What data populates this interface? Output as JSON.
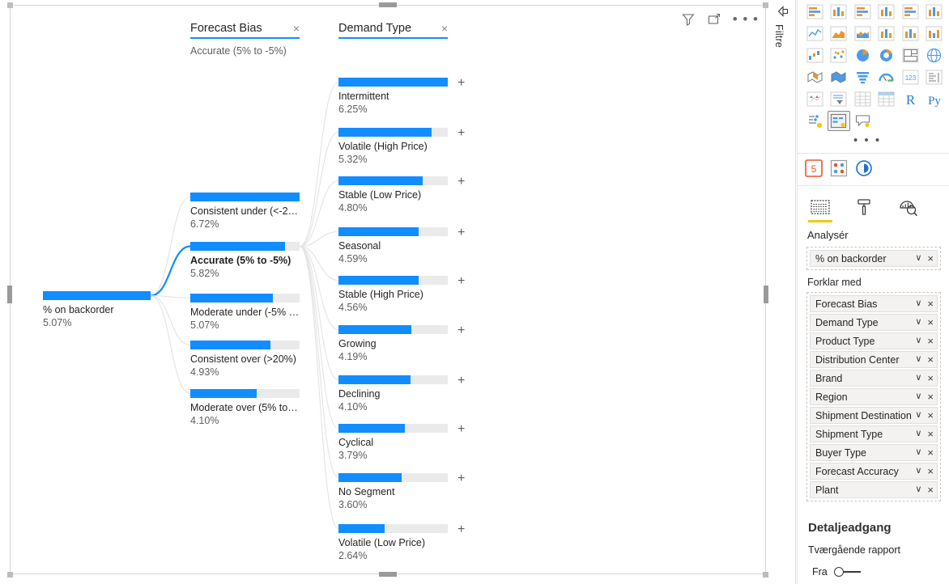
{
  "visual_toolbar": {
    "filter_icon": "funnel-icon",
    "focus_icon": "focus-mode-icon",
    "more_label": "• • •"
  },
  "filter_rail": {
    "collapse_icon": "collapse-pane-icon",
    "label": "Filtre"
  },
  "tree": {
    "root": {
      "label": "% on backorder",
      "value": "5.07%",
      "fill_ratio": 1.0,
      "selected": false
    },
    "levels": [
      {
        "title": "Forecast Bias",
        "subtitle": "Accurate (5% to -5%)",
        "close_label": "×",
        "nodes": [
          {
            "label": "Consistent under (<-2…",
            "value": "6.72%",
            "fill_ratio": 1.0,
            "selected": false,
            "expandable": false
          },
          {
            "label": "Accurate (5% to -5%)",
            "value": "5.82%",
            "fill_ratio": 0.866,
            "selected": true,
            "expandable": false
          },
          {
            "label": "Moderate under (-5% …",
            "value": "5.07%",
            "fill_ratio": 0.754,
            "selected": false,
            "expandable": false
          },
          {
            "label": "Consistent over (>20%)",
            "value": "4.93%",
            "fill_ratio": 0.734,
            "selected": false,
            "expandable": false
          },
          {
            "label": "Moderate over (5% to …",
            "value": "4.10%",
            "fill_ratio": 0.61,
            "selected": false,
            "expandable": false
          }
        ]
      },
      {
        "title": "Demand Type",
        "subtitle": "",
        "close_label": "×",
        "expand_label": "+",
        "nodes": [
          {
            "label": "Intermittent",
            "value": "6.25%",
            "fill_ratio": 1.0,
            "selected": false,
            "expandable": true
          },
          {
            "label": "Volatile (High Price)",
            "value": "5.32%",
            "fill_ratio": 0.851,
            "selected": false,
            "expandable": true
          },
          {
            "label": "Stable (Low Price)",
            "value": "4.80%",
            "fill_ratio": 0.768,
            "selected": false,
            "expandable": true
          },
          {
            "label": "Seasonal",
            "value": "4.59%",
            "fill_ratio": 0.734,
            "selected": false,
            "expandable": true
          },
          {
            "label": "Stable (High Price)",
            "value": "4.56%",
            "fill_ratio": 0.73,
            "selected": false,
            "expandable": true
          },
          {
            "label": "Growing",
            "value": "4.19%",
            "fill_ratio": 0.67,
            "selected": false,
            "expandable": true
          },
          {
            "label": "Declining",
            "value": "4.10%",
            "fill_ratio": 0.656,
            "selected": false,
            "expandable": true
          },
          {
            "label": "Cyclical",
            "value": "3.79%",
            "fill_ratio": 0.606,
            "selected": false,
            "expandable": true
          },
          {
            "label": "No Segment",
            "value": "3.60%",
            "fill_ratio": 0.576,
            "selected": false,
            "expandable": true
          },
          {
            "label": "Volatile (Low Price)",
            "value": "2.64%",
            "fill_ratio": 0.422,
            "selected": false,
            "expandable": true
          }
        ]
      }
    ]
  },
  "pane": {
    "gallery_icons": [
      "stacked-bar-chart-icon",
      "stacked-column-chart-icon",
      "clustered-bar-chart-icon",
      "clustered-column-chart-icon",
      "100-stacked-bar-chart-icon",
      "100-stacked-column-chart-icon",
      "line-chart-icon",
      "area-chart-icon",
      "stacked-area-chart-icon",
      "line-stacked-column-chart-icon",
      "line-clustered-column-chart-icon",
      "ribbon-chart-icon",
      "waterfall-chart-icon",
      "scatter-chart-icon",
      "pie-chart-icon",
      "donut-chart-icon",
      "treemap-icon",
      "map-icon",
      "filled-map-icon",
      "shape-map-icon",
      "funnel-chart-icon",
      "gauge-chart-icon",
      "card-icon",
      "multi-row-card-icon",
      "kpi-icon",
      "slicer-icon",
      "table-icon",
      "matrix-icon",
      "r-script-visual-icon",
      "python-visual-icon",
      "key-influencers-icon",
      "decomposition-tree-icon",
      "qa-visual-icon"
    ],
    "gallery_more_label": "• • •",
    "active_gallery_icon": "decomposition-tree-icon",
    "custom_visual_icons": [
      "html-visual-icon",
      "custom-visual-icon",
      "power-visual-icon"
    ],
    "tabs": [
      {
        "icon": "fields-icon",
        "name": "tab-fields",
        "active": true
      },
      {
        "icon": "format-icon",
        "name": "tab-format",
        "active": false
      },
      {
        "icon": "analytics-icon",
        "name": "tab-analytics",
        "active": false
      }
    ],
    "analyze": {
      "section_label": "Analysér",
      "field": {
        "name": "% on backorder",
        "chevron": "∨",
        "remove": "×"
      }
    },
    "explain_by": {
      "label": "Forklar med",
      "fields": [
        {
          "name": "Forecast Bias"
        },
        {
          "name": "Demand Type"
        },
        {
          "name": "Product Type"
        },
        {
          "name": "Distribution Center"
        },
        {
          "name": "Brand"
        },
        {
          "name": "Region"
        },
        {
          "name": "Shipment Destination"
        },
        {
          "name": "Shipment Type"
        },
        {
          "name": "Buyer Type"
        },
        {
          "name": "Forecast Accuracy"
        },
        {
          "name": "Plant"
        }
      ],
      "chevron": "∨",
      "remove": "×"
    },
    "drillthrough": {
      "title": "Detaljeadgang",
      "subtitle": "Tværgående rapport",
      "toggle_label": "Fra",
      "toggle_on": false
    }
  },
  "colors": {
    "accent": "#118DFF",
    "track": "#eaeaea",
    "edge": "#e3e3e3",
    "edge_active": "#118DFF",
    "tab_underline": "#F2C811",
    "text": "#252423",
    "text_muted": "#605e5c"
  }
}
